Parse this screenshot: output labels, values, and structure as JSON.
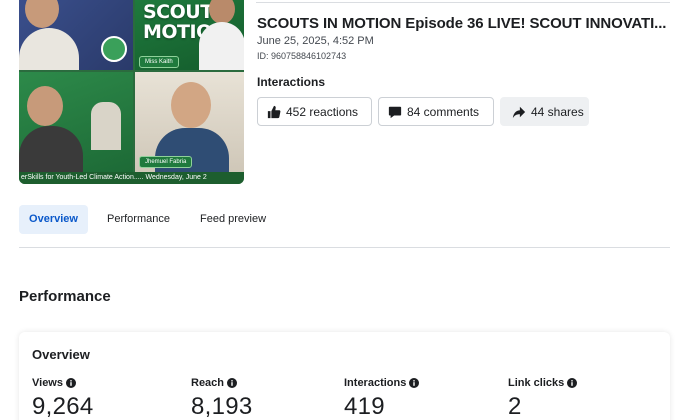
{
  "thumbnail": {
    "show_title": "SCOUT\nMOTIO",
    "name_tag_1": "Miss Kaith",
    "name_tag_2": "Jhemuel Fabria",
    "caption": "erSkills for Youth-Led Climate Action..... Wednesday, June 2"
  },
  "post": {
    "title": "SCOUTS IN MOTION Episode 36 LIVE! SCOUT INNOVATI...",
    "date": "June 25, 2025, 4:52 PM",
    "id": "ID: 960758846102743"
  },
  "interactions": {
    "label": "Interactions",
    "reactions": "452 reactions",
    "comments": "84 comments",
    "shares": "44 shares"
  },
  "tabs": [
    {
      "label": "Overview",
      "active": true
    },
    {
      "label": "Performance",
      "active": false
    },
    {
      "label": "Feed preview",
      "active": false
    }
  ],
  "performance": {
    "section_title": "Performance",
    "card_title": "Overview",
    "metrics": [
      {
        "label": "Views",
        "value": "9,264"
      },
      {
        "label": "Reach",
        "value": "8,193"
      },
      {
        "label": "Interactions",
        "value": "419"
      },
      {
        "label": "Link clicks",
        "value": "2"
      }
    ]
  },
  "colors": {
    "accent": "#0a58ca",
    "active_tab_bg": "#e7f0fb",
    "border": "#ccd0d5"
  },
  "icons": [
    "thumbs-up-icon",
    "comment-icon",
    "share-icon",
    "info-icon"
  ]
}
